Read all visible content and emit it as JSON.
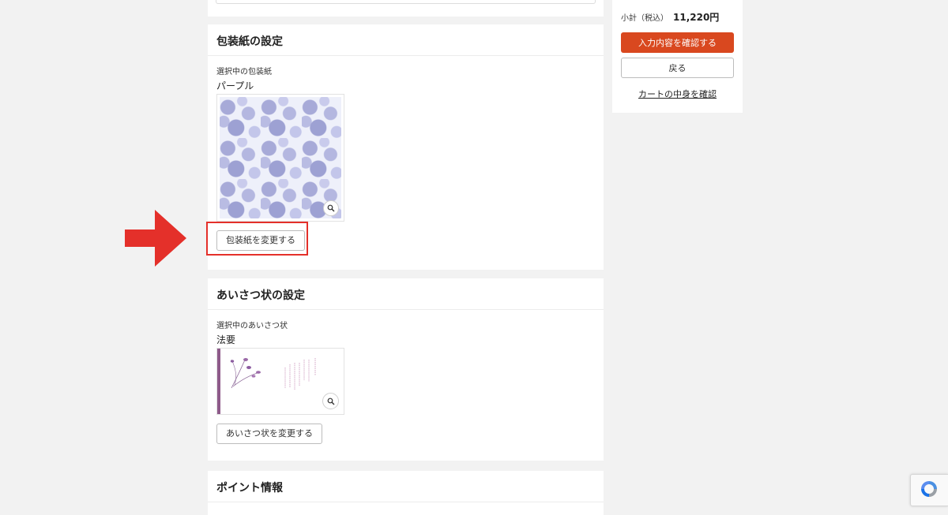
{
  "wrapping": {
    "title": "包装紙の設定",
    "selected_label": "選択中の包装紙",
    "selected_value": "パープル",
    "change_button": "包装紙を変更する"
  },
  "greeting": {
    "title": "あいさつ状の設定",
    "selected_label": "選択中のあいさつ状",
    "selected_value": "法要",
    "change_button": "あいさつ状を変更する"
  },
  "points": {
    "title": "ポイント情報"
  },
  "sidebar": {
    "subtotal_label": "小計（税込）",
    "subtotal_amount": "11,220円",
    "confirm_button": "入力内容を確認する",
    "back_button": "戻る",
    "cart_link": "カートの中身を確認"
  },
  "colors": {
    "primary": "#d9481f",
    "highlight": "#e4302a",
    "background": "#f2f2f2"
  },
  "icons": {
    "zoom": "magnifier-icon",
    "pointer": "arrow-right-icon",
    "captcha": "recaptcha-icon"
  }
}
